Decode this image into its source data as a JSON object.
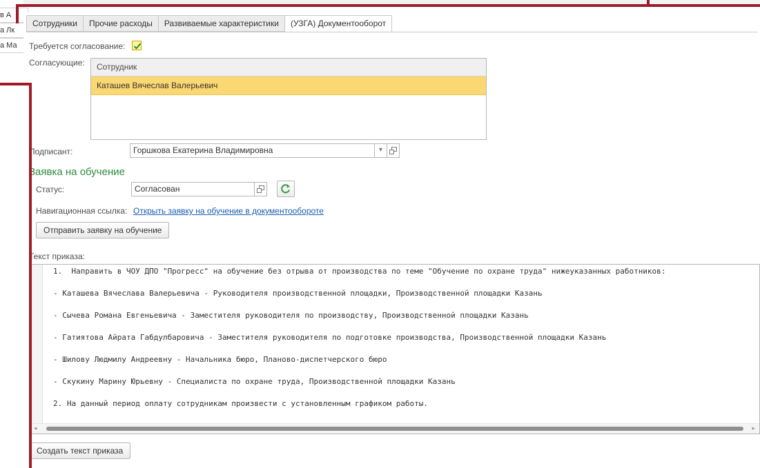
{
  "background": {
    "left_rows": [
      "в А",
      "а Лк",
      "а Ма"
    ]
  },
  "tabs": [
    {
      "label": "Сотрудники",
      "active": false
    },
    {
      "label": "Прочие расходы",
      "active": false
    },
    {
      "label": "Развиваемые характеристики",
      "active": false
    },
    {
      "label": "(УЗГА) Документооборот",
      "active": true
    }
  ],
  "approval": {
    "required_label": "Требуется согласование:",
    "required_checked": true,
    "approvers_label": "Согласующие:",
    "grid_header": "Сотрудник",
    "approvers": [
      "Каташев Вячеслав Валерьевич"
    ]
  },
  "signer": {
    "label": "Подписант:",
    "value": "Горшкова Екатерина Владимировна"
  },
  "training_request": {
    "title": "Заявка на обучение",
    "status_label": "Статус:",
    "status_value": "Согласован",
    "nav_link_label": "Навигационная ссылка:",
    "nav_link_text": "Открыть заявку на обучение в документообороте",
    "send_button": "Отправить заявку на обучение"
  },
  "order_text": {
    "label": "Текст приказа:",
    "lines": [
      "1.  Направить в ЧОУ ДПО \"Прогресс\" на обучение без отрыва от производства по теме \"Обучение по охране труда\" нижеуказанных работников:",
      "- Каташева Вячеслава Валерьевича - Руководителя производственной площадки, Производственной площадки Казань",
      "- Сычева Романа Евгеньевича - Заместителя руководителя по производству, Производственной площадки Казань",
      "- Гатиятова Айрата Габдулбаровича - Заместителя руководителя по подготовке производства, Производственной площадки Казань",
      "- Шилову Людмилу Андреевну - Начальника бюро, Планово-диспетчерского бюро",
      "- Скукину Марину Юрьевну - Специалиста по охране труда, Производственной площадки Казань",
      "2. На данный период оплату сотрудникам произвести с установленным графиком работы."
    ],
    "create_button": "Создать текст приказа"
  },
  "colors": {
    "annotation_frame": "#9c1c2a",
    "selected_row": "#fcd873",
    "section_title": "#2b8a3e",
    "link": "#1a5eb0"
  }
}
